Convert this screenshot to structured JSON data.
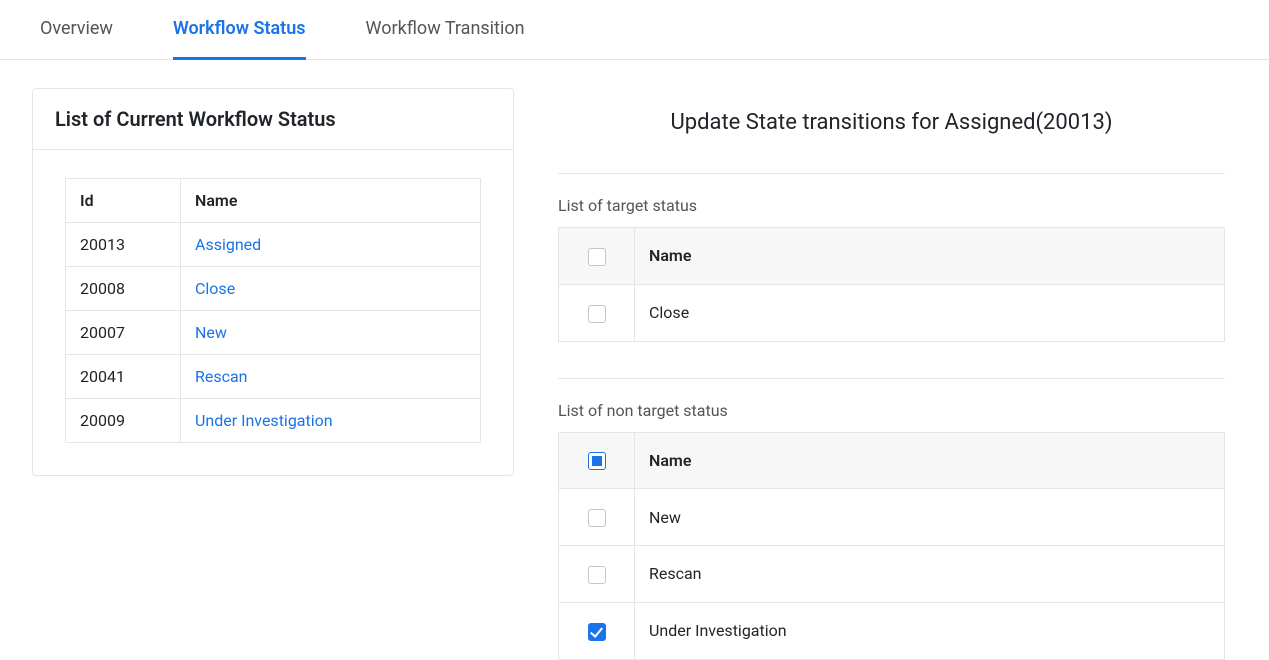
{
  "tabs": [
    {
      "label": "Overview",
      "active": false
    },
    {
      "label": "Workflow Status",
      "active": true
    },
    {
      "label": "Workflow Transition",
      "active": false
    }
  ],
  "left": {
    "title": "List of Current Workflow Status",
    "id_header": "Id",
    "name_header": "Name",
    "rows": [
      {
        "id": "20013",
        "name": "Assigned"
      },
      {
        "id": "20008",
        "name": "Close"
      },
      {
        "id": "20007",
        "name": "New"
      },
      {
        "id": "20041",
        "name": "Rescan"
      },
      {
        "id": "20009",
        "name": "Under Investigation"
      }
    ]
  },
  "right": {
    "title": "Update State transitions for Assigned(20013)",
    "target_label": "List of target status",
    "target_name_header": "Name",
    "target_rows": [
      {
        "name": "Close",
        "checked": false
      }
    ],
    "nontarget_label": "List of non target status",
    "nontarget_name_header": "Name",
    "nontarget_header_state": "indeterminate",
    "nontarget_rows": [
      {
        "name": "New",
        "checked": false
      },
      {
        "name": "Rescan",
        "checked": false
      },
      {
        "name": "Under Investigation",
        "checked": true
      }
    ]
  }
}
